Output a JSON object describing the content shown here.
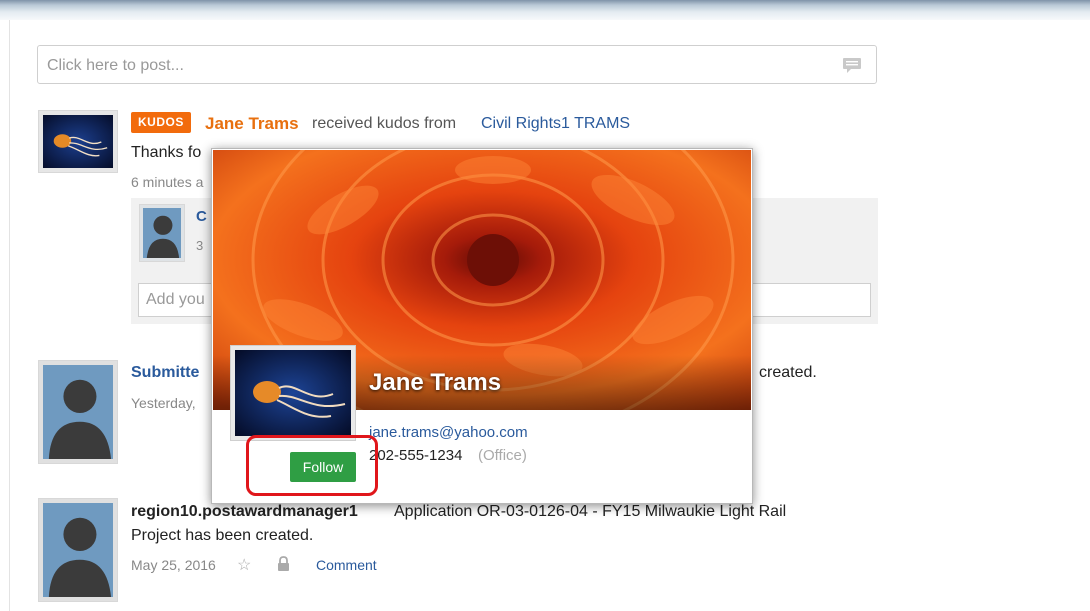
{
  "composer": {
    "placeholder": "Click here to post..."
  },
  "feed": {
    "item1": {
      "badge": "KUDOS",
      "recipient": "Jane Trams",
      "action": "received kudos from",
      "sender": "Civil Rights1 TRAMS",
      "message_visible": "Thanks fo",
      "time_visible": "6 minutes a",
      "comment_author_visible": "C",
      "comment_time_visible": "3",
      "comment_placeholder_visible": "Add you"
    },
    "item2": {
      "author_visible": "Submitte",
      "text_tail": "created.",
      "time_visible": "Yesterday,"
    },
    "item3": {
      "author": "region10.postawardmanager1",
      "text_line1": "Application OR-03-0126-04 - FY15 Milwaukie Light Rail",
      "text_line2": "Project has been created.",
      "date": "May 25, 2016",
      "comment_label": "Comment"
    }
  },
  "popup": {
    "name": "Jane Trams",
    "email": "jane.trams@yahoo.com",
    "phone": "202-555-1234",
    "phone_type": "(Office)",
    "follow_label": "Follow"
  },
  "colors": {
    "accent": "#f26b0c",
    "link": "#2a5a9c",
    "follow": "#2f9e44",
    "highlight": "#e0161b"
  },
  "icons": [
    "chat-bubble-icon",
    "star-icon",
    "lock-icon",
    "jellyfish-avatar",
    "default-person-avatar"
  ]
}
